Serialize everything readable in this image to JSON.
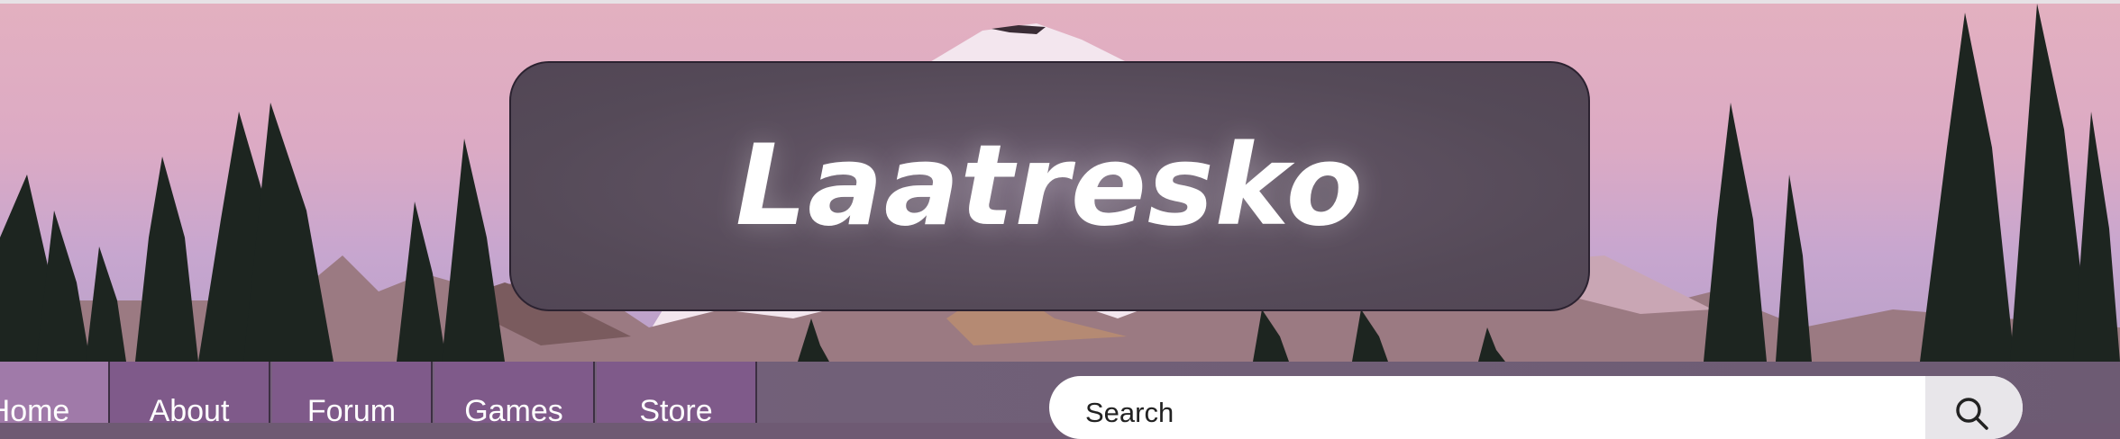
{
  "site": {
    "title": "Laatresko"
  },
  "nav": {
    "items": [
      {
        "label": "Home"
      },
      {
        "label": "About"
      },
      {
        "label": "Forum"
      },
      {
        "label": "Games"
      },
      {
        "label": "Store"
      }
    ]
  },
  "search": {
    "placeholder": "Search"
  },
  "colors": {
    "nav_active": "#a07aa9",
    "nav_item": "#7f5a8a",
    "title_box": "#554a58"
  }
}
